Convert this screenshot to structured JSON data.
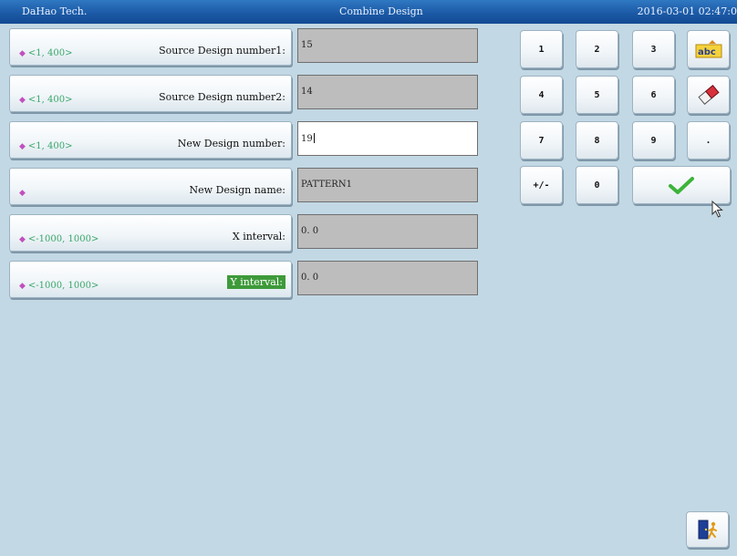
{
  "titlebar": {
    "app_name": "DaHao Tech.",
    "title": "Combine Design",
    "datetime": "2016-03-01 02:47:0"
  },
  "params": [
    {
      "range": "<1, 400>",
      "label": "Source Design number1:",
      "value": "15"
    },
    {
      "range": "<1, 400>",
      "label": "Source Design number2:",
      "value": "14"
    },
    {
      "range": "<1, 400>",
      "label": "New Design number:",
      "value": "19"
    },
    {
      "range": "",
      "label": "New Design name:",
      "value": "PATTERN1"
    },
    {
      "range": "<-1000, 1000>",
      "label": "X interval:",
      "value": "0. 0"
    },
    {
      "range": "<-1000, 1000>",
      "label": "Y interval:",
      "value": "0. 0"
    }
  ],
  "keypad": {
    "k1": "1",
    "k2": "2",
    "k3": "3",
    "k4": "4",
    "k5": "5",
    "k6": "6",
    "k7": "7",
    "k8": "8",
    "k9": "9",
    "dot": ".",
    "sign": "+/-",
    "k0": "0",
    "abc_icon_text": "abc"
  },
  "colors": {
    "titlebar": "#1c5aa6",
    "background": "#c2d8e4",
    "active_label": "#3e9a3a",
    "range_text": "#3aa66a",
    "value_box": "#bdbdbd",
    "confirm_check": "#3db33a"
  },
  "icons": {
    "input_method": "abc-input-icon",
    "clear": "eraser-icon",
    "confirm": "checkmark-icon",
    "exit": "exit-door-icon",
    "range_marker": "diamond-icon"
  }
}
